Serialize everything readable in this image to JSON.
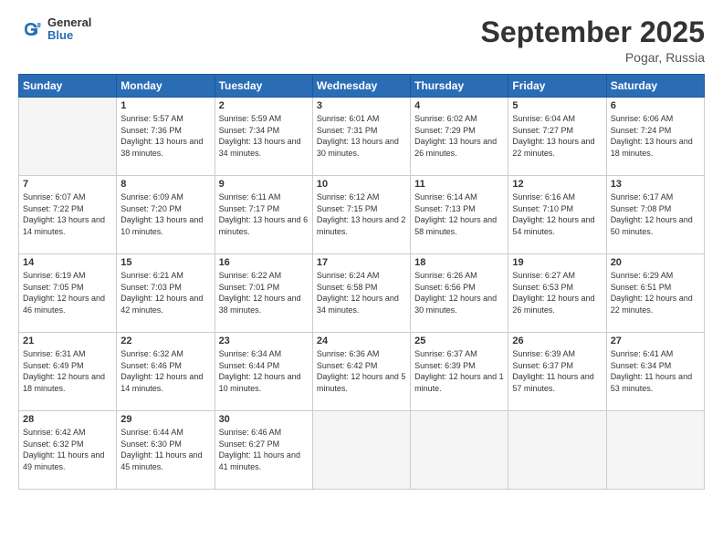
{
  "header": {
    "logo_general": "General",
    "logo_blue": "Blue",
    "month_title": "September 2025",
    "location": "Pogar, Russia"
  },
  "days_of_week": [
    "Sunday",
    "Monday",
    "Tuesday",
    "Wednesday",
    "Thursday",
    "Friday",
    "Saturday"
  ],
  "weeks": [
    [
      {
        "day": "",
        "sunrise": "",
        "sunset": "",
        "daylight": "",
        "empty": true
      },
      {
        "day": "1",
        "sunrise": "Sunrise: 5:57 AM",
        "sunset": "Sunset: 7:36 PM",
        "daylight": "Daylight: 13 hours and 38 minutes.",
        "empty": false
      },
      {
        "day": "2",
        "sunrise": "Sunrise: 5:59 AM",
        "sunset": "Sunset: 7:34 PM",
        "daylight": "Daylight: 13 hours and 34 minutes.",
        "empty": false
      },
      {
        "day": "3",
        "sunrise": "Sunrise: 6:01 AM",
        "sunset": "Sunset: 7:31 PM",
        "daylight": "Daylight: 13 hours and 30 minutes.",
        "empty": false
      },
      {
        "day": "4",
        "sunrise": "Sunrise: 6:02 AM",
        "sunset": "Sunset: 7:29 PM",
        "daylight": "Daylight: 13 hours and 26 minutes.",
        "empty": false
      },
      {
        "day": "5",
        "sunrise": "Sunrise: 6:04 AM",
        "sunset": "Sunset: 7:27 PM",
        "daylight": "Daylight: 13 hours and 22 minutes.",
        "empty": false
      },
      {
        "day": "6",
        "sunrise": "Sunrise: 6:06 AM",
        "sunset": "Sunset: 7:24 PM",
        "daylight": "Daylight: 13 hours and 18 minutes.",
        "empty": false
      }
    ],
    [
      {
        "day": "7",
        "sunrise": "Sunrise: 6:07 AM",
        "sunset": "Sunset: 7:22 PM",
        "daylight": "Daylight: 13 hours and 14 minutes.",
        "empty": false
      },
      {
        "day": "8",
        "sunrise": "Sunrise: 6:09 AM",
        "sunset": "Sunset: 7:20 PM",
        "daylight": "Daylight: 13 hours and 10 minutes.",
        "empty": false
      },
      {
        "day": "9",
        "sunrise": "Sunrise: 6:11 AM",
        "sunset": "Sunset: 7:17 PM",
        "daylight": "Daylight: 13 hours and 6 minutes.",
        "empty": false
      },
      {
        "day": "10",
        "sunrise": "Sunrise: 6:12 AM",
        "sunset": "Sunset: 7:15 PM",
        "daylight": "Daylight: 13 hours and 2 minutes.",
        "empty": false
      },
      {
        "day": "11",
        "sunrise": "Sunrise: 6:14 AM",
        "sunset": "Sunset: 7:13 PM",
        "daylight": "Daylight: 12 hours and 58 minutes.",
        "empty": false
      },
      {
        "day": "12",
        "sunrise": "Sunrise: 6:16 AM",
        "sunset": "Sunset: 7:10 PM",
        "daylight": "Daylight: 12 hours and 54 minutes.",
        "empty": false
      },
      {
        "day": "13",
        "sunrise": "Sunrise: 6:17 AM",
        "sunset": "Sunset: 7:08 PM",
        "daylight": "Daylight: 12 hours and 50 minutes.",
        "empty": false
      }
    ],
    [
      {
        "day": "14",
        "sunrise": "Sunrise: 6:19 AM",
        "sunset": "Sunset: 7:05 PM",
        "daylight": "Daylight: 12 hours and 46 minutes.",
        "empty": false
      },
      {
        "day": "15",
        "sunrise": "Sunrise: 6:21 AM",
        "sunset": "Sunset: 7:03 PM",
        "daylight": "Daylight: 12 hours and 42 minutes.",
        "empty": false
      },
      {
        "day": "16",
        "sunrise": "Sunrise: 6:22 AM",
        "sunset": "Sunset: 7:01 PM",
        "daylight": "Daylight: 12 hours and 38 minutes.",
        "empty": false
      },
      {
        "day": "17",
        "sunrise": "Sunrise: 6:24 AM",
        "sunset": "Sunset: 6:58 PM",
        "daylight": "Daylight: 12 hours and 34 minutes.",
        "empty": false
      },
      {
        "day": "18",
        "sunrise": "Sunrise: 6:26 AM",
        "sunset": "Sunset: 6:56 PM",
        "daylight": "Daylight: 12 hours and 30 minutes.",
        "empty": false
      },
      {
        "day": "19",
        "sunrise": "Sunrise: 6:27 AM",
        "sunset": "Sunset: 6:53 PM",
        "daylight": "Daylight: 12 hours and 26 minutes.",
        "empty": false
      },
      {
        "day": "20",
        "sunrise": "Sunrise: 6:29 AM",
        "sunset": "Sunset: 6:51 PM",
        "daylight": "Daylight: 12 hours and 22 minutes.",
        "empty": false
      }
    ],
    [
      {
        "day": "21",
        "sunrise": "Sunrise: 6:31 AM",
        "sunset": "Sunset: 6:49 PM",
        "daylight": "Daylight: 12 hours and 18 minutes.",
        "empty": false
      },
      {
        "day": "22",
        "sunrise": "Sunrise: 6:32 AM",
        "sunset": "Sunset: 6:46 PM",
        "daylight": "Daylight: 12 hours and 14 minutes.",
        "empty": false
      },
      {
        "day": "23",
        "sunrise": "Sunrise: 6:34 AM",
        "sunset": "Sunset: 6:44 PM",
        "daylight": "Daylight: 12 hours and 10 minutes.",
        "empty": false
      },
      {
        "day": "24",
        "sunrise": "Sunrise: 6:36 AM",
        "sunset": "Sunset: 6:42 PM",
        "daylight": "Daylight: 12 hours and 5 minutes.",
        "empty": false
      },
      {
        "day": "25",
        "sunrise": "Sunrise: 6:37 AM",
        "sunset": "Sunset: 6:39 PM",
        "daylight": "Daylight: 12 hours and 1 minute.",
        "empty": false
      },
      {
        "day": "26",
        "sunrise": "Sunrise: 6:39 AM",
        "sunset": "Sunset: 6:37 PM",
        "daylight": "Daylight: 11 hours and 57 minutes.",
        "empty": false
      },
      {
        "day": "27",
        "sunrise": "Sunrise: 6:41 AM",
        "sunset": "Sunset: 6:34 PM",
        "daylight": "Daylight: 11 hours and 53 minutes.",
        "empty": false
      }
    ],
    [
      {
        "day": "28",
        "sunrise": "Sunrise: 6:42 AM",
        "sunset": "Sunset: 6:32 PM",
        "daylight": "Daylight: 11 hours and 49 minutes.",
        "empty": false
      },
      {
        "day": "29",
        "sunrise": "Sunrise: 6:44 AM",
        "sunset": "Sunset: 6:30 PM",
        "daylight": "Daylight: 11 hours and 45 minutes.",
        "empty": false
      },
      {
        "day": "30",
        "sunrise": "Sunrise: 6:46 AM",
        "sunset": "Sunset: 6:27 PM",
        "daylight": "Daylight: 11 hours and 41 minutes.",
        "empty": false
      },
      {
        "day": "",
        "sunrise": "",
        "sunset": "",
        "daylight": "",
        "empty": true
      },
      {
        "day": "",
        "sunrise": "",
        "sunset": "",
        "daylight": "",
        "empty": true
      },
      {
        "day": "",
        "sunrise": "",
        "sunset": "",
        "daylight": "",
        "empty": true
      },
      {
        "day": "",
        "sunrise": "",
        "sunset": "",
        "daylight": "",
        "empty": true
      }
    ]
  ]
}
